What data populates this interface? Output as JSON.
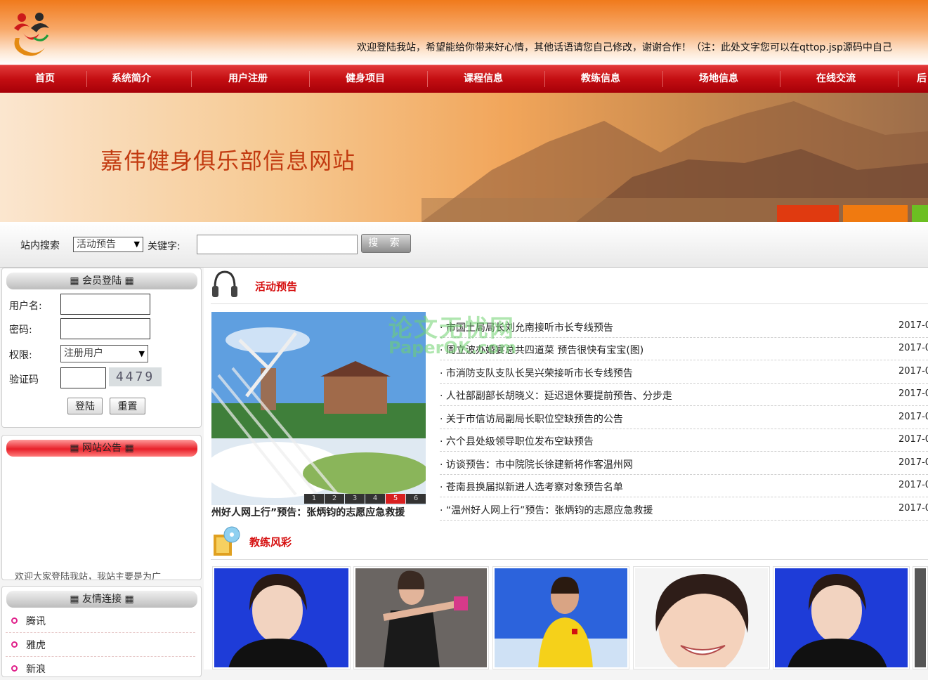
{
  "header": {
    "marquee": "欢迎登陆我站，希望能给你带来好心情，其他话语请您自己修改，谢谢合作！（注：此处文字您可以在qttop.jsp源码中自己"
  },
  "nav": {
    "items": [
      "首页",
      "系统简介",
      "用户注册",
      "健身项目",
      "课程信息",
      "教练信息",
      "场地信息",
      "在线交流",
      "后"
    ]
  },
  "banner": {
    "title": "嘉伟健身俱乐部信息网站"
  },
  "search": {
    "label": "站内搜索",
    "category_value": "活动预告",
    "keyword_label": "关键字:",
    "button": "搜 索"
  },
  "login": {
    "title": "会员登陆",
    "username_label": "用户名:",
    "password_label": "密码:",
    "role_label": "权限:",
    "role_value": "注册用户",
    "captcha_label": "验证码",
    "captcha_value": "4479",
    "login_button": "登陆",
    "reset_button": "重置"
  },
  "notice": {
    "title": "网站公告",
    "text": "欢迎大家登陆我站，我站主要是为广"
  },
  "links": {
    "title": "友情连接",
    "items": [
      "腾讯",
      "雅虎",
      "新浪"
    ]
  },
  "activity": {
    "title": "活动预告",
    "slide_caption": "州好人网上行”预告：张炳钧的志愿应急救援",
    "slide_numbers": [
      "1",
      "2",
      "3",
      "4",
      "5",
      "6"
    ],
    "active_slide": "5",
    "news": [
      {
        "title": "· 市国土局局长刘允南接听市长专线预告",
        "date": "2017-0"
      },
      {
        "title": "· 周立波办婚宴总共四道菜 预告很快有宝宝(图)",
        "date": "2017-0"
      },
      {
        "title": "· 市消防支队支队长吴兴荣接听市长专线预告",
        "date": "2017-0"
      },
      {
        "title": "· 人社部副部长胡晓义：延迟退休要提前预告、分步走",
        "date": "2017-0"
      },
      {
        "title": "· 关于市信访局副局长职位空缺预告的公告",
        "date": "2017-0"
      },
      {
        "title": "· 六个县处级领导职位发布空缺预告",
        "date": "2017-0"
      },
      {
        "title": "· 访谈预告：市中院院长徐建新将作客温州网",
        "date": "2017-0"
      },
      {
        "title": "· 苍南县换届拟新进人选考察对象预告名单",
        "date": "2017-0"
      },
      {
        "title": "· “温州好人网上行”预告：张炳钧的志愿应急救援",
        "date": "2017-0"
      }
    ]
  },
  "coaches": {
    "title": "教练风彩"
  },
  "watermark": {
    "line1": "论文无忧网",
    "line2": "PaperOK.com"
  },
  "colors": {
    "nav_red": "#c40e12",
    "section_title_red": "#d61010",
    "header_orange": "#f07a1c"
  }
}
